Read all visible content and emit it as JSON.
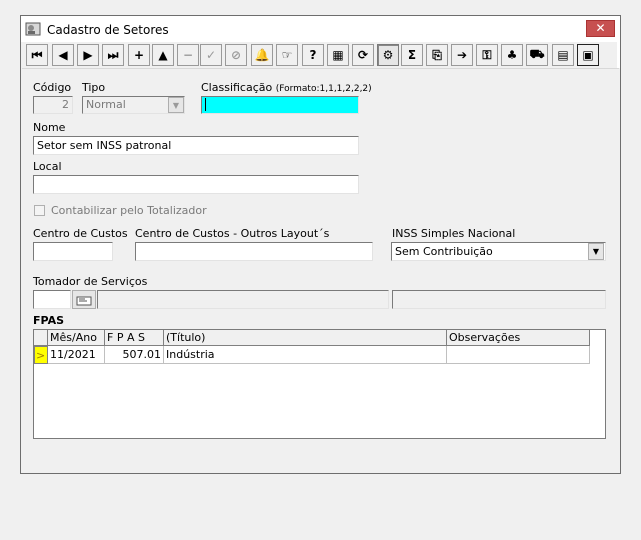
{
  "window": {
    "title": "Cadastro de Setores",
    "close_symbol": "✕"
  },
  "toolbar": {
    "buttons": [
      {
        "name": "first-record-button",
        "glyph": "⏮"
      },
      {
        "name": "prior-record-button",
        "glyph": "◀"
      },
      {
        "name": "next-record-button",
        "glyph": "▶"
      },
      {
        "name": "last-record-button",
        "glyph": "⏭"
      },
      {
        "name": "insert-button",
        "glyph": "+"
      },
      {
        "name": "edit-button",
        "glyph": "▲"
      },
      {
        "name": "delete-button",
        "glyph": "−"
      },
      {
        "name": "post-button",
        "glyph": "✓"
      },
      {
        "name": "cancel-button",
        "glyph": "⊘"
      },
      {
        "name": "bell-button",
        "glyph": "🔔"
      },
      {
        "name": "pointer-button",
        "glyph": "☞"
      },
      {
        "name": "search-button",
        "glyph": "?"
      },
      {
        "name": "grid-button",
        "glyph": "▦"
      },
      {
        "name": "refresh-button",
        "glyph": "⟳"
      },
      {
        "name": "org-button",
        "glyph": "⚙"
      },
      {
        "name": "sum-button",
        "glyph": "Σ"
      },
      {
        "name": "copy-button",
        "glyph": "⎘"
      },
      {
        "name": "export-button",
        "glyph": "➔"
      },
      {
        "name": "key-button",
        "glyph": "⚿"
      },
      {
        "name": "tree-button",
        "glyph": "♣"
      },
      {
        "name": "vehicle-button",
        "glyph": "⛟"
      },
      {
        "name": "calendar-button",
        "glyph": "▤"
      },
      {
        "name": "exit-button",
        "glyph": "▣"
      }
    ]
  },
  "form": {
    "codigo_label": "Código",
    "codigo_value": "2",
    "tipo_label": "Tipo",
    "tipo_value": "Normal",
    "classificacao_label": "Classificação",
    "classificacao_format": "(Formato:1,1,1,2,2,2)",
    "classificacao_value": "",
    "nome_label": "Nome",
    "nome_value": "Setor sem INSS patronal",
    "local_label": "Local",
    "local_value": "",
    "contabilizar_label": "Contabilizar pelo Totalizador",
    "centro_custos_label": "Centro de Custos",
    "centro_custos_value": "",
    "centro_outros_label": "Centro de Custos - Outros Layout´s",
    "centro_outros_value": "",
    "inss_label": "INSS Simples Nacional",
    "inss_value": "Sem Contribuição",
    "tomador_label": "Tomador de Serviços",
    "tomador_code": "",
    "tomador_name": "",
    "tomador_extra": ""
  },
  "fpas": {
    "section_label": "FPAS",
    "columns": [
      "Mês/Ano",
      "F P A S",
      "(Título)",
      "Observações"
    ],
    "rows": [
      {
        "indicator": ">",
        "mes_ano": "11/2021",
        "fpas": "507.01",
        "titulo": "Indústria",
        "observacoes": ""
      }
    ]
  },
  "colors": {
    "highlight_field": "#00ffff",
    "row_indicator": "#ffff00",
    "close_button": "#c75050"
  }
}
